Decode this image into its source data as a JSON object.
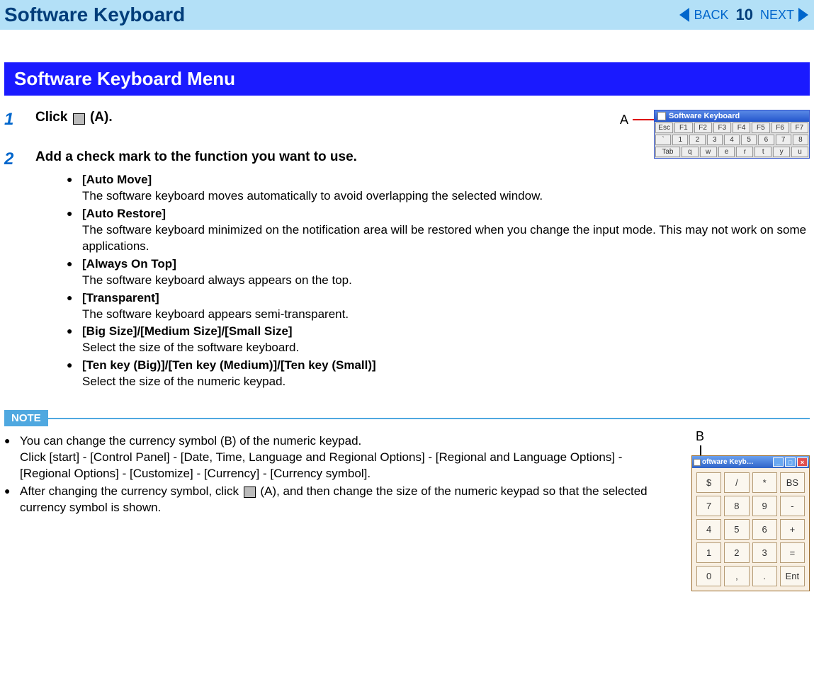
{
  "header": {
    "title": "Software Keyboard",
    "back": "BACK",
    "next": "NEXT",
    "page": "10"
  },
  "section": {
    "heading": "Software Keyboard Menu"
  },
  "steps": [
    {
      "num": "1",
      "title_before": "Click ",
      "title_after": " (A)."
    },
    {
      "num": "2",
      "title": "Add a check mark to the function you want to use.",
      "bullets": [
        {
          "label": "[Auto Move]",
          "desc": "The software keyboard moves automatically to avoid overlapping the selected window."
        },
        {
          "label": "[Auto Restore]",
          "desc": "The software keyboard minimized on the notification area will be restored when you change the input mode. This may not work on some applications."
        },
        {
          "label": "[Always On Top]",
          "desc": "The software keyboard always appears on the top."
        },
        {
          "label": "[Transparent]",
          "desc": "The software keyboard appears semi-transparent."
        },
        {
          "label": "[Big Size]/[Medium Size]/[Small Size]",
          "desc": "Select the size of the software keyboard."
        },
        {
          "label": "[Ten key (Big)]/[Ten key (Medium)]/[Ten key (Small)]",
          "desc": "Select the size of the numeric keypad."
        }
      ]
    }
  ],
  "note": {
    "label": "NOTE",
    "items": [
      {
        "line1": "You can change the currency symbol (B) of the numeric keypad.",
        "line2": "Click [start] - [Control Panel] - [Date, Time, Language and Regional Options] - [Regional and Language Options] - [Regional Options] - [Customize] - [Currency] - [Currency symbol]."
      },
      {
        "text_before": "After changing the currency symbol, click ",
        "text_after": " (A), and then change the size of the numeric keypad so that the selected currency symbol is shown."
      }
    ]
  },
  "figA": {
    "label": "A",
    "title": "Software Keyboard",
    "row1": [
      "Esc",
      "F1",
      "F2",
      "F3",
      "F4",
      "F5",
      "F6",
      "F7"
    ],
    "row2": [
      "`",
      "1",
      "2",
      "3",
      "4",
      "5",
      "6",
      "7",
      "8"
    ],
    "row3": [
      "Tab",
      "q",
      "w",
      "e",
      "r",
      "t",
      "y",
      "u"
    ]
  },
  "figB": {
    "label": "B",
    "title": "oftware Keyb…",
    "keys": [
      "$",
      "/",
      "*",
      "BS",
      "7",
      "8",
      "9",
      "-",
      "4",
      "5",
      "6",
      "+",
      "1",
      "2",
      "3",
      "=",
      "0",
      ",",
      ".",
      "Ent"
    ]
  }
}
